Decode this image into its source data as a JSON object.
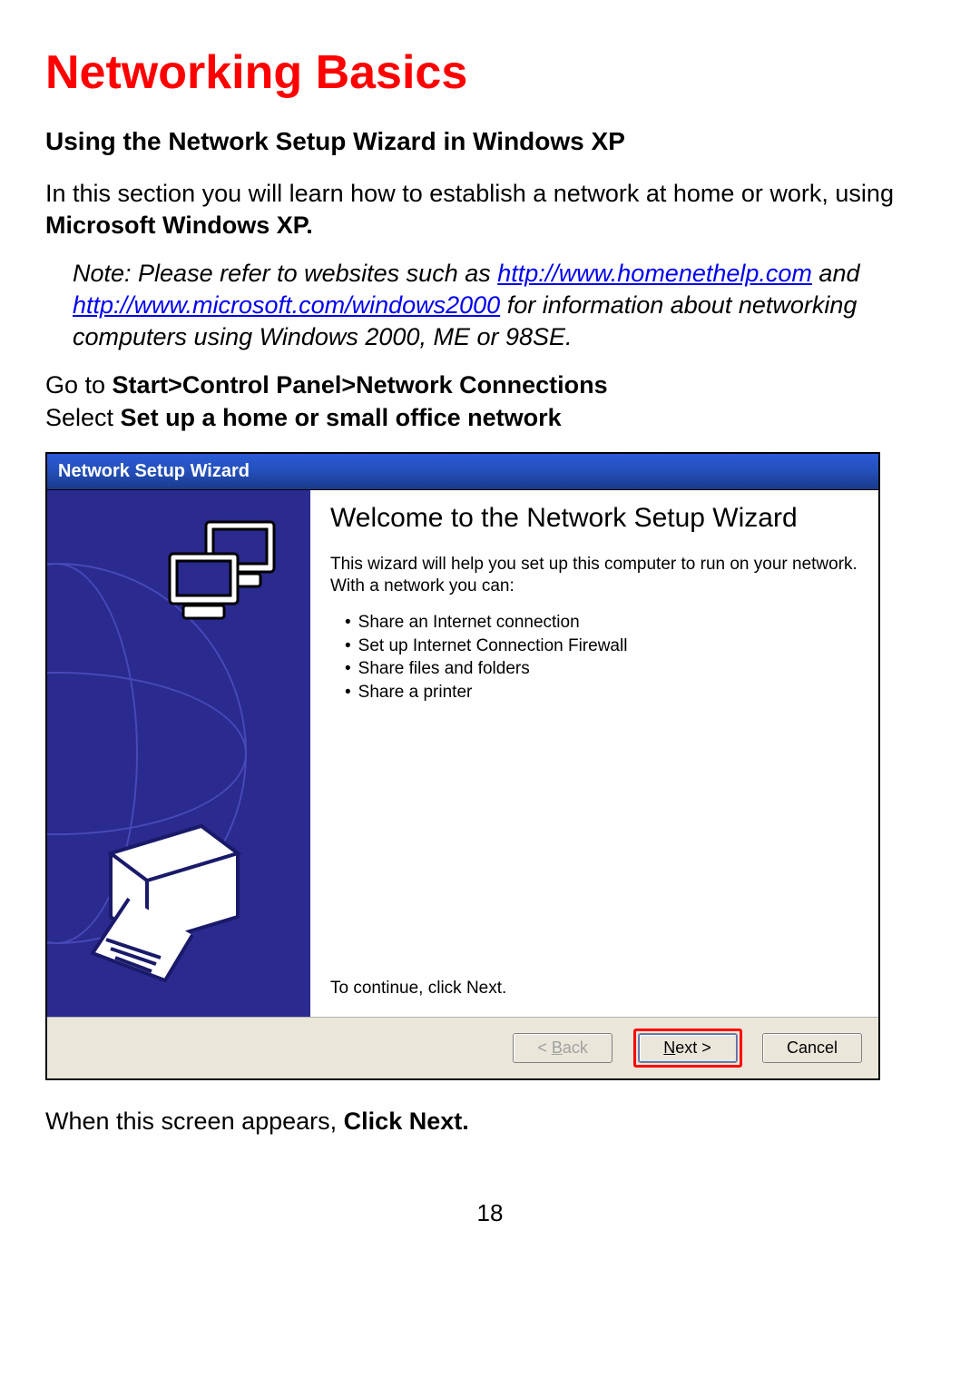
{
  "doc": {
    "title": "Networking Basics",
    "subtitle": "Using the Network Setup Wizard in Windows XP",
    "intro_pre": "In this section you will learn how to establish a network at home or work, using ",
    "intro_bold": "Microsoft Windows XP.",
    "note_pre": "Note:  Please refer to websites such as ",
    "note_link1": "http://www.homenethelp.com",
    "note_mid": " and ",
    "note_link2": "http://www.microsoft.com/windows2000",
    "note_post": "  for information about networking computers using Windows 2000, ME or 98SE.",
    "step1_pre": "Go to ",
    "step1_bold": "Start>Control Panel>Network Connections",
    "step2_pre": "Select ",
    "step2_bold": "Set up a home or small office network",
    "after_pre": "When this screen appears, ",
    "after_bold": "Click Next.",
    "page_number": "18"
  },
  "wizard": {
    "title": "Network Setup Wizard",
    "heading": "Welcome to the Network Setup Wizard",
    "intro": "This wizard will help you set up this computer to run on your network. With a network you can:",
    "bullets": [
      "Share an Internet connection",
      "Set up Internet Connection Firewall",
      "Share files and folders",
      "Share a printer"
    ],
    "continue_text": "To continue, click Next.",
    "buttons": {
      "back": "< Back",
      "next": "Next >",
      "cancel": "Cancel"
    }
  }
}
